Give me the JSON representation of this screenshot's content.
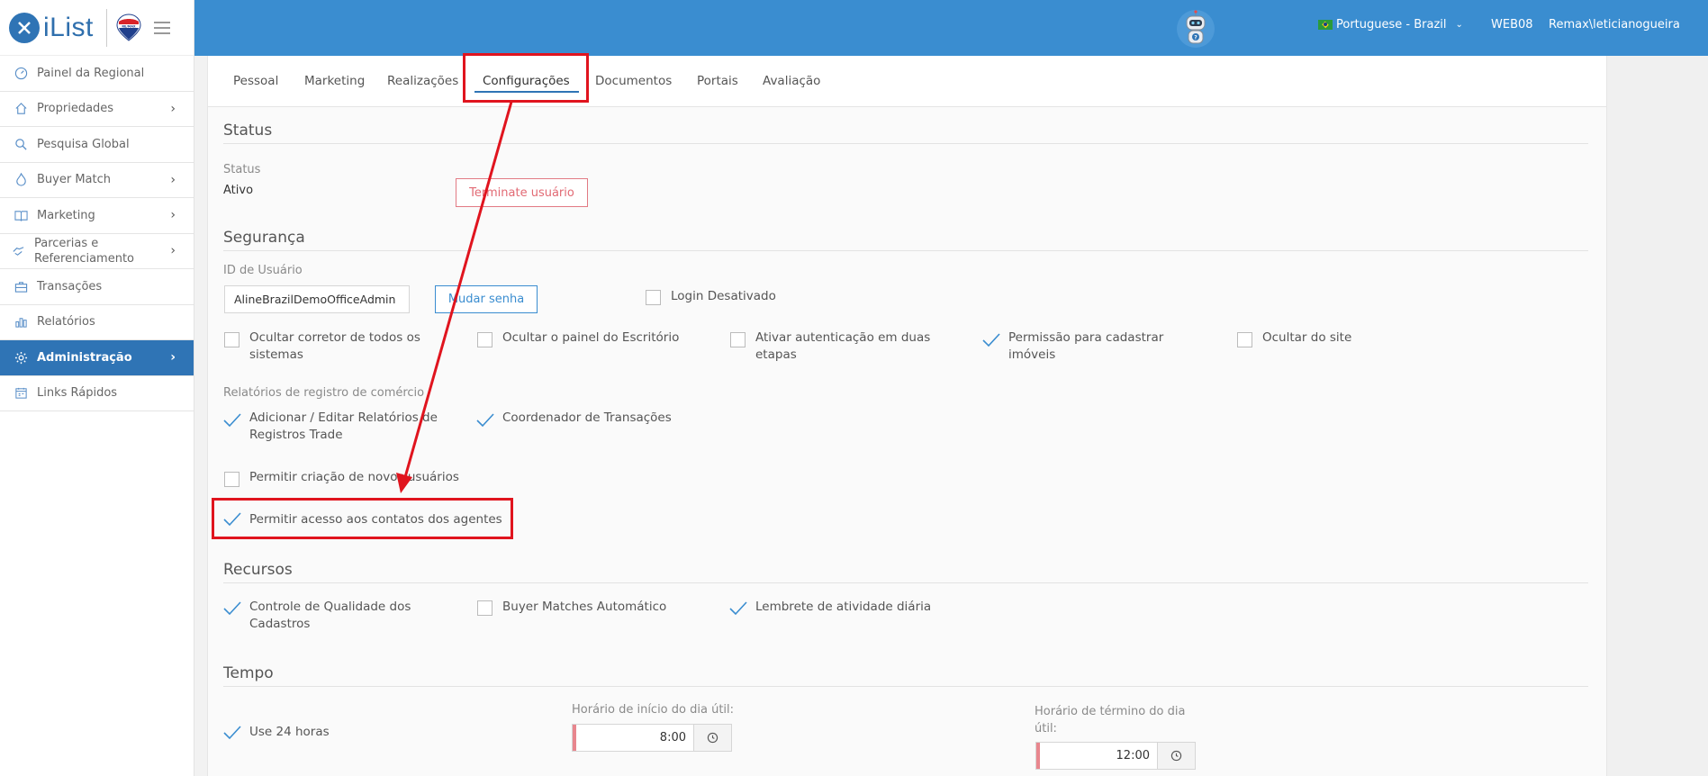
{
  "app": {
    "logo_text": "iList",
    "logo_letter": "✕",
    "remax_text": "RE/MAX"
  },
  "sidebar": {
    "items": [
      {
        "label": "Painel da Regional",
        "icon": "gauge-icon",
        "chevron": false
      },
      {
        "label": "Propriedades",
        "icon": "home-icon",
        "chevron": true
      },
      {
        "label": "Pesquisa Global",
        "icon": "search-icon",
        "chevron": false
      },
      {
        "label": "Buyer Match",
        "icon": "flame-icon",
        "chevron": true
      },
      {
        "label": "Marketing",
        "icon": "book-icon",
        "chevron": true
      },
      {
        "label_line1": "Parcerias e",
        "label_line2": "Referenciamento",
        "icon": "handshake-icon",
        "chevron": true
      },
      {
        "label": "Transações",
        "icon": "briefcase-icon",
        "chevron": false
      },
      {
        "label": "Relatórios",
        "icon": "bar-chart-icon",
        "chevron": false
      },
      {
        "label": "Administração",
        "icon": "gear-icon",
        "chevron": true,
        "active": true
      },
      {
        "label": "Links Rápidos",
        "icon": "calendar-icon",
        "chevron": false
      }
    ]
  },
  "topbar": {
    "language": "Portuguese - Brazil",
    "office": "WEB08",
    "user": "Remax\\leticianogueira"
  },
  "tabs": [
    "Pessoal",
    "Marketing",
    "Realizações",
    "Configurações",
    "Documentos",
    "Portais",
    "Avaliação"
  ],
  "active_tab": "Configurações",
  "status_section": {
    "title": "Status",
    "label": "Status",
    "value": "Ativo",
    "terminate_button": "Terminate usuário"
  },
  "security_section": {
    "title": "Segurança",
    "user_id_label": "ID de Usuário",
    "user_id_value": "AlineBrazilDemoOfficeAdmin",
    "change_password_button": "Mudar senha",
    "login_disabled_label": "Login Desativado",
    "options": [
      {
        "line1": "Ocultar corretor de todos os",
        "line2": "sistemas",
        "checked": false
      },
      {
        "line1": "Ocultar o painel do Escritório",
        "line2": "",
        "checked": false
      },
      {
        "line1": "Ativar autenticação em duas",
        "line2": "etapas",
        "checked": false
      },
      {
        "line1": "Permissão para cadastrar",
        "line2": "imóveis",
        "checked": true
      },
      {
        "line1": "Ocultar do site",
        "line2": "",
        "checked": false
      }
    ],
    "trade_reports_label": "Relatórios de registro de comércio",
    "trade_options": [
      {
        "line1": "Adicionar / Editar Relatórios de",
        "line2": "Registros Trade",
        "checked": true
      },
      {
        "line1": "Coordenador de Transações",
        "line2": "",
        "checked": true
      }
    ],
    "allow_new_users": {
      "label": "Permitir criação de novos usuários",
      "checked": false
    },
    "allow_agent_contacts": {
      "label": "Permitir acesso aos contatos dos agentes",
      "checked": true
    }
  },
  "resources_section": {
    "title": "Recursos",
    "options": [
      {
        "line1": "Controle de Qualidade dos",
        "line2": "Cadastros",
        "checked": true
      },
      {
        "line1": "Buyer Matches Automático",
        "line2": "",
        "checked": false
      },
      {
        "line1": "Lembrete de atividade diária",
        "line2": "",
        "checked": true
      }
    ]
  },
  "time_section": {
    "title": "Tempo",
    "use_24h": {
      "label": "Use 24 horas",
      "checked": true
    },
    "start_label": "Horário de início do dia útil:",
    "start_value": "8:00",
    "end_label_line1": "Horário de término do dia",
    "end_label_line2": "útil:",
    "end_value": "12:00"
  },
  "colors": {
    "topbar": "#3a8dd0",
    "sidebar_active": "#2f74b5",
    "annotation_red": "#e0141e",
    "tick_blue": "#3a8dd0"
  }
}
